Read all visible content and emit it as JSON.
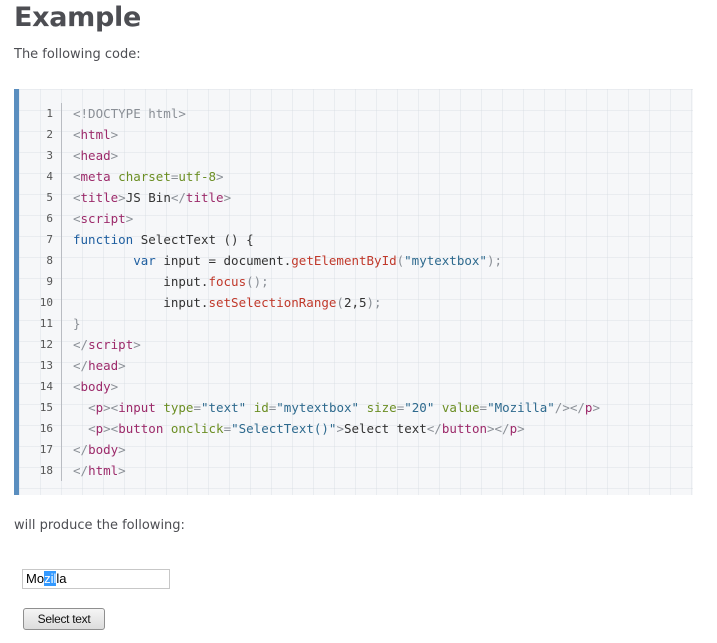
{
  "page": {
    "title": "Example",
    "intro": "The following code:",
    "outro": "will produce the following:"
  },
  "code": {
    "line_numbers": [
      "1",
      "2",
      "3",
      "4",
      "5",
      "6",
      "7",
      "8",
      "9",
      "10",
      "11",
      "12",
      "13",
      "14",
      "15",
      "16",
      "17",
      "18"
    ],
    "lines": [
      [
        [
          "punct",
          "<!DOCTYPE html>"
        ]
      ],
      [
        [
          "punct",
          "<"
        ],
        [
          "tag",
          "html"
        ],
        [
          "punct",
          ">"
        ]
      ],
      [
        [
          "punct",
          "<"
        ],
        [
          "tag",
          "head"
        ],
        [
          "punct",
          ">"
        ]
      ],
      [
        [
          "punct",
          "<"
        ],
        [
          "tag",
          "meta"
        ],
        [
          "plain",
          " "
        ],
        [
          "attr",
          "charset"
        ],
        [
          "punct",
          "="
        ],
        [
          "attr",
          "utf-8"
        ],
        [
          "punct",
          ">"
        ]
      ],
      [
        [
          "punct",
          "<"
        ],
        [
          "tag",
          "title"
        ],
        [
          "punct",
          ">"
        ],
        [
          "plain",
          "JS Bin"
        ],
        [
          "punct",
          "</"
        ],
        [
          "tag",
          "title"
        ],
        [
          "punct",
          ">"
        ]
      ],
      [
        [
          "punct",
          "<"
        ],
        [
          "tag",
          "script"
        ],
        [
          "punct",
          ">"
        ]
      ],
      [
        [
          "kw",
          "function"
        ],
        [
          "plain",
          " SelectText () {"
        ]
      ],
      [
        [
          "plain",
          "        "
        ],
        [
          "kw",
          "var"
        ],
        [
          "plain",
          " input = document."
        ],
        [
          "fn",
          "getElementById"
        ],
        [
          "punct",
          "("
        ],
        [
          "str",
          "\"mytextbox\""
        ],
        [
          "punct",
          ");"
        ]
      ],
      [
        [
          "plain",
          "            input."
        ],
        [
          "fn",
          "focus"
        ],
        [
          "punct",
          "();"
        ]
      ],
      [
        [
          "plain",
          "            input."
        ],
        [
          "fn",
          "setSelectionRange"
        ],
        [
          "punct",
          "("
        ],
        [
          "plain",
          "2,5"
        ],
        [
          "punct",
          ");"
        ]
      ],
      [
        [
          "punct",
          "}"
        ]
      ],
      [
        [
          "punct",
          "</"
        ],
        [
          "tag",
          "script"
        ],
        [
          "punct",
          ">"
        ]
      ],
      [
        [
          "punct",
          "</"
        ],
        [
          "tag",
          "head"
        ],
        [
          "punct",
          ">"
        ]
      ],
      [
        [
          "punct",
          "<"
        ],
        [
          "tag",
          "body"
        ],
        [
          "punct",
          ">"
        ]
      ],
      [
        [
          "plain",
          "  "
        ],
        [
          "punct",
          "<"
        ],
        [
          "tag",
          "p"
        ],
        [
          "punct",
          "><"
        ],
        [
          "tag",
          "input"
        ],
        [
          "plain",
          " "
        ],
        [
          "attr",
          "type"
        ],
        [
          "punct",
          "="
        ],
        [
          "str",
          "\"text\""
        ],
        [
          "plain",
          " "
        ],
        [
          "attr",
          "id"
        ],
        [
          "punct",
          "="
        ],
        [
          "str",
          "\"mytextbox\""
        ],
        [
          "plain",
          " "
        ],
        [
          "attr",
          "size"
        ],
        [
          "punct",
          "="
        ],
        [
          "str",
          "\"20\""
        ],
        [
          "plain",
          " "
        ],
        [
          "attr",
          "value"
        ],
        [
          "punct",
          "="
        ],
        [
          "str",
          "\"Mozilla\""
        ],
        [
          "punct",
          "/></"
        ],
        [
          "tag",
          "p"
        ],
        [
          "punct",
          ">"
        ]
      ],
      [
        [
          "plain",
          "  "
        ],
        [
          "punct",
          "<"
        ],
        [
          "tag",
          "p"
        ],
        [
          "punct",
          "><"
        ],
        [
          "tag",
          "button"
        ],
        [
          "plain",
          " "
        ],
        [
          "attr",
          "onclick"
        ],
        [
          "punct",
          "="
        ],
        [
          "str",
          "\"SelectText()\""
        ],
        [
          "punct",
          ">"
        ],
        [
          "plain",
          "Select text"
        ],
        [
          "punct",
          "</"
        ],
        [
          "tag",
          "button"
        ],
        [
          "punct",
          "></"
        ],
        [
          "tag",
          "p"
        ],
        [
          "punct",
          ">"
        ]
      ],
      [
        [
          "punct",
          "</"
        ],
        [
          "tag",
          "body"
        ],
        [
          "punct",
          ">"
        ]
      ],
      [
        [
          "punct",
          "</"
        ],
        [
          "tag",
          "html"
        ],
        [
          "punct",
          ">"
        ]
      ]
    ]
  },
  "demo": {
    "input_before": "Mo",
    "input_selected": "zil",
    "input_after": "la",
    "button_label": "Select text"
  },
  "colors": {
    "code_border": "#5a8ebf",
    "code_background": "#f6f7f9",
    "selection": "#3399ff"
  }
}
